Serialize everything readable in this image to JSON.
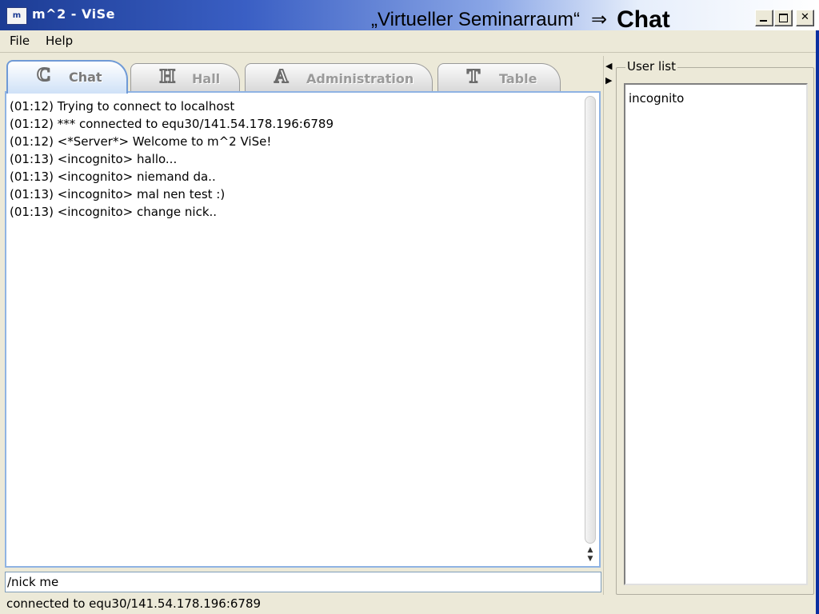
{
  "window": {
    "icon_text": "m",
    "title": "m^2 - ViSe"
  },
  "slide_caption": {
    "prefix": "„Virtueller Seminarraum“",
    "arrow": "⇒",
    "highlight": "Chat"
  },
  "menu": {
    "file": "File",
    "help": "Help"
  },
  "tabs": [
    {
      "icon": "C",
      "label": "Chat",
      "active": true
    },
    {
      "icon": "H",
      "label": "Hall",
      "active": false
    },
    {
      "icon": "A",
      "label": "Administration",
      "active": false
    },
    {
      "icon": "T",
      "label": "Table",
      "active": false
    }
  ],
  "chat": {
    "lines": [
      "(01:12) Trying to connect to localhost",
      "(01:12) *** connected to equ30/141.54.178.196:6789",
      "(01:12) <*Server*> Welcome to m^2 ViSe!",
      "(01:13) <incognito> hallo...",
      "(01:13) <incognito> niemand da..",
      "(01:13) <incognito> mal nen test :)",
      "(01:13) <incognito> change nick.."
    ],
    "input_value": "/nick me"
  },
  "status": "connected to equ30/141.54.178.196:6789",
  "user_list": {
    "title": "User list",
    "users": [
      "incognito"
    ]
  },
  "icons": {
    "minimize": "minimize-icon",
    "maximize": "maximize-icon",
    "close": "close-icon",
    "scroll_up": "▲",
    "scroll_down": "▼",
    "split_left": "◀",
    "split_right": "▶"
  }
}
